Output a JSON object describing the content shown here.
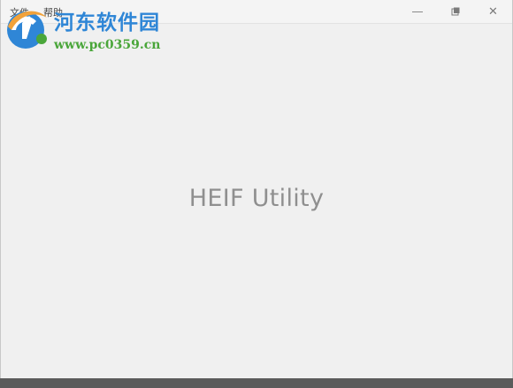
{
  "app": {
    "title": "HEIF Utility"
  },
  "menu": {
    "items": [
      {
        "label": "文件"
      },
      {
        "label": "帮助"
      }
    ]
  },
  "window_controls": {
    "minimize_icon": "minimize-icon",
    "restore_icon": "restore-icon",
    "close_icon": "close-icon",
    "close_glyph": "✕"
  },
  "watermark": {
    "site_name": "河东软件园",
    "url": "www.pc0359.cn",
    "colors": {
      "title": "#2f86d6",
      "url": "#4aa63a"
    }
  },
  "colors": {
    "background": "#f0f0f0",
    "title_text": "#8f8f8f",
    "bottom_bar": "#5b5b5b"
  }
}
